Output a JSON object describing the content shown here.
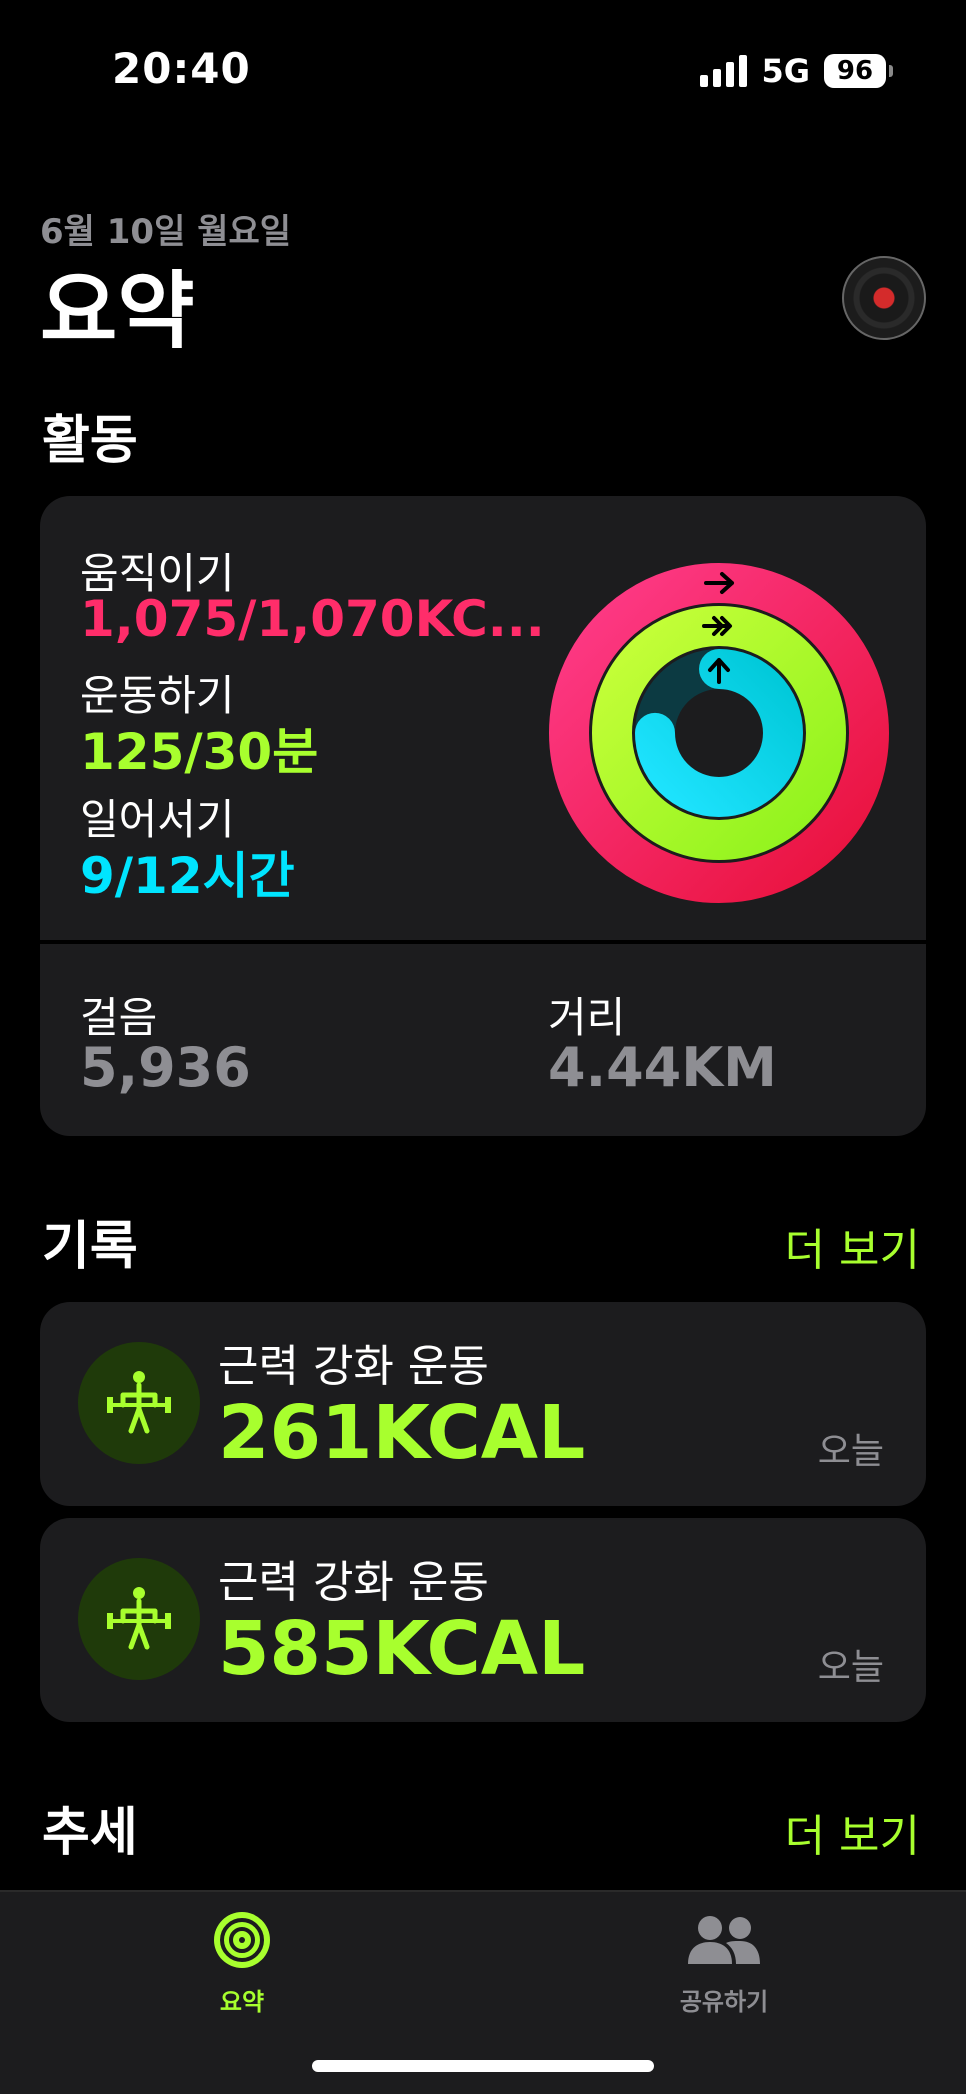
{
  "status": {
    "time": "20:40",
    "network": "5G",
    "battery": "96"
  },
  "header": {
    "date": "6월 10일 월요일",
    "title": "요약"
  },
  "activity": {
    "section_title": "활동",
    "move": {
      "label": "움직이기",
      "value": "1,075/1,070KC..."
    },
    "exercise": {
      "label": "운동하기",
      "value": "125/30분"
    },
    "stand": {
      "label": "일어서기",
      "value": "9/12시간"
    },
    "rings": {
      "move_progress": 1.005,
      "exercise_progress": 4.17,
      "stand_progress": 0.75
    },
    "steps": {
      "label": "걸음",
      "value": "5,936"
    },
    "distance": {
      "label": "거리",
      "value": "4.44KM"
    }
  },
  "history": {
    "section_title": "기록",
    "more": "더 보기",
    "workouts": [
      {
        "name": "근력 강화 운동",
        "kcal": "261KCAL",
        "date": "오늘"
      },
      {
        "name": "근력 강화 운동",
        "kcal": "585KCAL",
        "date": "오늘"
      }
    ]
  },
  "trends": {
    "section_title": "추세",
    "more": "더 보기"
  },
  "tabs": [
    {
      "label": "요약",
      "icon": "activity-rings-icon",
      "active": true
    },
    {
      "label": "공유하기",
      "icon": "people-icon",
      "active": false
    }
  ],
  "colors": {
    "move": "#ff2d6a",
    "exercise": "#a8ff2e",
    "stand": "#00e5ff",
    "accent": "#a8ff2e"
  }
}
